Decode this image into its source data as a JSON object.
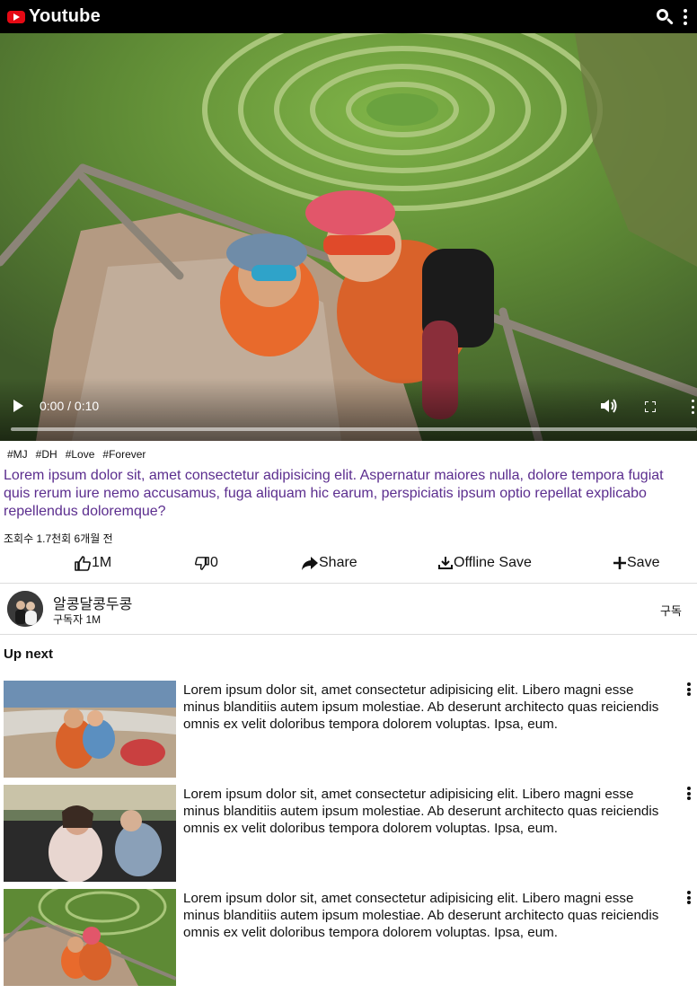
{
  "header": {
    "logo_text": "Youtube",
    "icons": [
      "youtube-logo-icon",
      "search-icon",
      "more-vert-icon"
    ]
  },
  "player": {
    "time": "0:00 / 0:10",
    "progress_fraction": 0,
    "icons": [
      "play-icon",
      "volume-icon",
      "fullscreen-icon",
      "more-vert-icon"
    ]
  },
  "video": {
    "tags": [
      "#MJ",
      "#DH",
      "#Love",
      "#Forever"
    ],
    "description": "Lorem ipsum dolor sit, amet consectetur adipisicing elit. Aspernatur maiores nulla, dolore tempora fugiat quis rerum iure nemo accusamus, fuga aliquam hic earum, perspiciatis ipsum optio repellat explicabo repellendus doloremque?",
    "views": "조회수 1.7천회 6개월 전",
    "description_color": "#5b2d8e"
  },
  "actions": {
    "like": "1M",
    "dislike": "0",
    "share": "Share",
    "offline_save": "Offline Save",
    "save": "Save"
  },
  "channel": {
    "name": "알콩달콩두콩",
    "subscribers": "구독자 1M",
    "subscribe_label": "구독"
  },
  "up_next": {
    "heading": "Up next",
    "items": [
      {
        "text": "Lorem ipsum dolor sit, amet consectetur adipisicing elit. Libero magni esse minus blanditiis autem ipsum molestiae. Ab deserunt architecto quas reiciendis omnis ex velit doloribus tempora dolorem voluptas. Ipsa, eum."
      },
      {
        "text": "Lorem ipsum dolor sit, amet consectetur adipisicing elit. Libero magni esse minus blanditiis autem ipsum molestiae. Ab deserunt architecto quas reiciendis omnis ex velit doloribus tempora dolorem voluptas. Ipsa, eum."
      },
      {
        "text": "Lorem ipsum dolor sit, amet consectetur adipisicing elit. Libero magni esse minus blanditiis autem ipsum molestiae. Ab deserunt architecto quas reiciendis omnis ex velit doloribus tempora dolorem voluptas. Ipsa, eum."
      }
    ]
  },
  "colors": {
    "header_bg": "#000000",
    "logo_red": "#e50914"
  }
}
